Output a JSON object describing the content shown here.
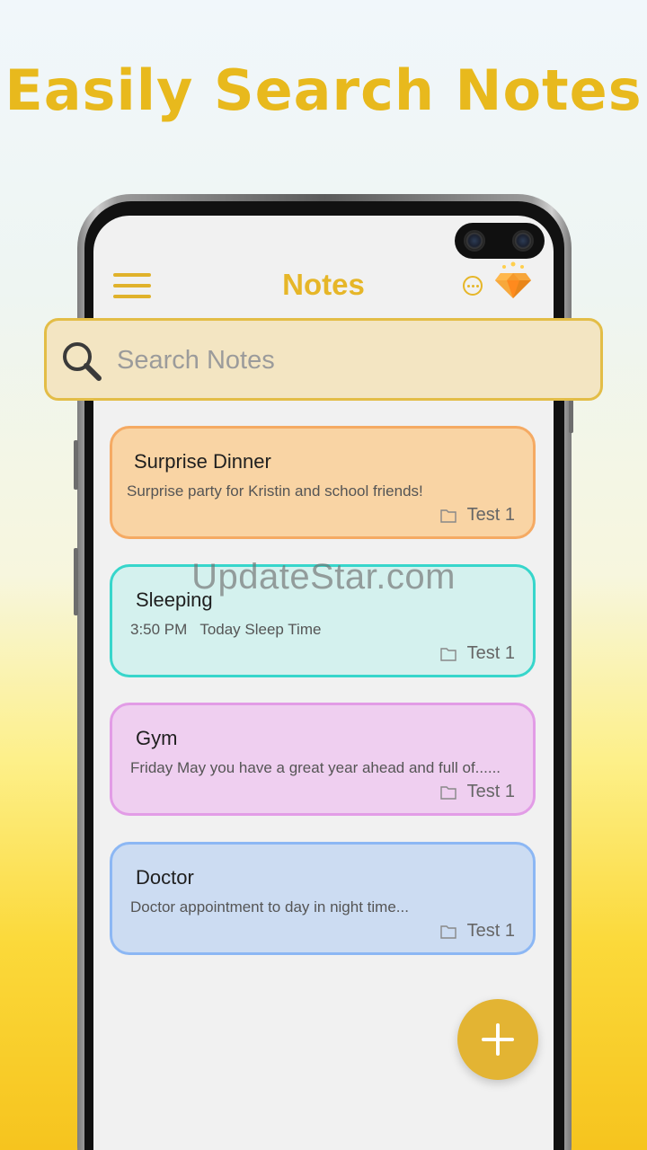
{
  "headline": "Easily Search Notes",
  "app": {
    "title": "Notes"
  },
  "search": {
    "placeholder": "Search Notes"
  },
  "notes": [
    {
      "title": "Surprise Dinner",
      "time": "",
      "text": "Surprise party for Kristin and school friends!",
      "folder": "Test 1",
      "bg": "#f9d4a4",
      "border": "#f5aa63"
    },
    {
      "title": "Sleeping",
      "time": "3:50 PM",
      "text": "Today Sleep Time",
      "folder": "Test 1",
      "bg": "#d4f1ee",
      "border": "#37d6cb"
    },
    {
      "title": "Gym",
      "time": "",
      "text": "Friday May you have a great year ahead and full of......",
      "folder": "Test 1",
      "bg": "#efcff0",
      "border": "#e29ce6"
    },
    {
      "title": "Doctor",
      "time": "",
      "text": "Doctor appointment to day in night time...",
      "folder": "Test 1",
      "bg": "#ccdcf2",
      "border": "#8cb7f4"
    }
  ],
  "watermark": "UpdateStar.com",
  "colors": {
    "accent": "#e6b628",
    "search_bg": "#f3e5c2",
    "fab": "#e3b433"
  },
  "icons": [
    "menu-icon",
    "more-icon",
    "gem-icon",
    "search-icon",
    "folder-icon",
    "plus-icon"
  ]
}
